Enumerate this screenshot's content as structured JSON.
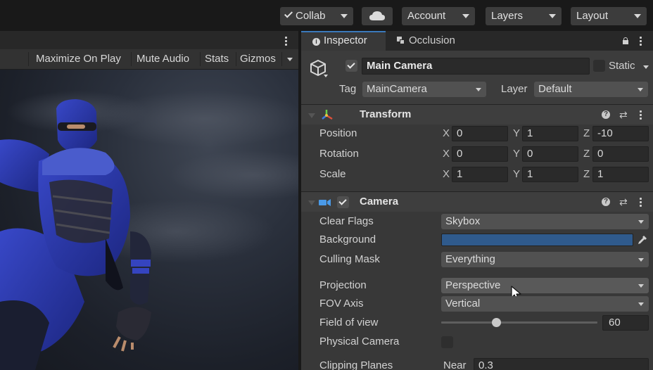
{
  "toolbar": {
    "collab_label": "Collab",
    "account_label": "Account",
    "layers_label": "Layers",
    "layout_label": "Layout"
  },
  "game_toolbar": {
    "maximize_label": "Maximize On Play",
    "mute_label": "Mute Audio",
    "stats_label": "Stats",
    "gizmos_label": "Gizmos"
  },
  "inspector": {
    "tabs": [
      {
        "label": "Inspector",
        "icon": "info-icon"
      },
      {
        "label": "Occlusion",
        "icon": "occlusion-icon"
      }
    ],
    "object": {
      "name": "Main Camera",
      "active": true,
      "static_label": "Static",
      "tag_label": "Tag",
      "tag_value": "MainCamera",
      "layer_label": "Layer",
      "layer_value": "Default"
    },
    "transform": {
      "title": "Transform",
      "rows": [
        {
          "label": "Position",
          "x": "0",
          "y": "1",
          "z": "-10"
        },
        {
          "label": "Rotation",
          "x": "0",
          "y": "0",
          "z": "0"
        },
        {
          "label": "Scale",
          "x": "1",
          "y": "1",
          "z": "1"
        }
      ],
      "axis_x": "X",
      "axis_y": "Y",
      "axis_z": "Z"
    },
    "camera": {
      "title": "Camera",
      "enabled": true,
      "clear_flags_label": "Clear Flags",
      "clear_flags_value": "Skybox",
      "background_label": "Background",
      "background_color": "#2f5a8c",
      "culling_mask_label": "Culling Mask",
      "culling_mask_value": "Everything",
      "projection_label": "Projection",
      "projection_value": "Perspective",
      "fov_axis_label": "FOV Axis",
      "fov_axis_value": "Vertical",
      "fov_label": "Field of view",
      "fov_value": "60",
      "fov_slider_fraction": 0.35,
      "physical_label": "Physical Camera",
      "physical_checked": false,
      "clipping_label": "Clipping Planes",
      "near_label": "Near",
      "near_value": "0.3"
    }
  },
  "colors": {
    "accent_blue": "#2f5a8c",
    "panel": "#383838",
    "toolbar": "#191919"
  }
}
